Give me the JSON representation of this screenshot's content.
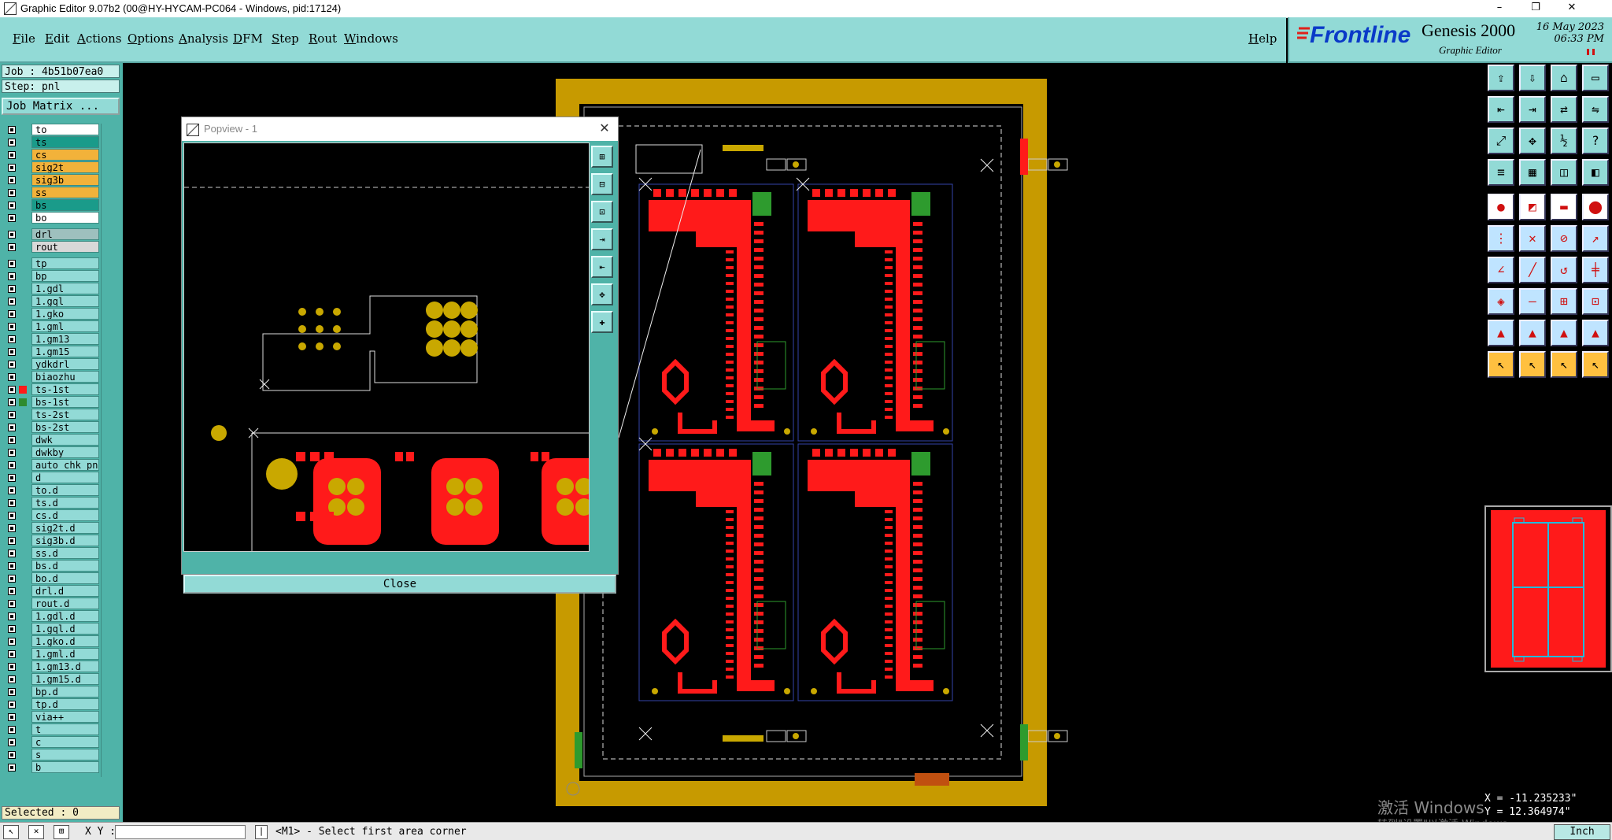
{
  "window": {
    "title": "Graphic Editor 9.07b2 (00@HY-HYCAM-PC064 - Windows, pid:17124)",
    "minimize": "–",
    "restore": "❐",
    "close": "✕"
  },
  "menu": {
    "items": [
      "File",
      "Edit",
      "Actions",
      "Options",
      "Analysis",
      "DFM",
      "Step",
      "Rout",
      "Windows"
    ],
    "help": "Help"
  },
  "logo": {
    "brand": "Frontline",
    "product": "Genesis 2000",
    "subtitle": "Graphic Editor",
    "date": "16 May 2023",
    "time": "06:33 PM"
  },
  "job": {
    "job_label": "Job : 4b51b07ea0",
    "step_label": "Step: pnl",
    "matrix_button": "Job Matrix ..."
  },
  "layers": [
    {
      "name": "to",
      "color": "#ffffff",
      "group": 0
    },
    {
      "name": "ts",
      "color": "#1a9b8a",
      "group": 0
    },
    {
      "name": "cs",
      "color": "#f2b23a",
      "group": 0
    },
    {
      "name": "sig2t",
      "color": "#f2b23a",
      "group": 0
    },
    {
      "name": "sig3b",
      "color": "#f2b23a",
      "group": 0
    },
    {
      "name": "ss",
      "color": "#f2b23a",
      "group": 0
    },
    {
      "name": "bs",
      "color": "#1a9b8a",
      "group": 0
    },
    {
      "name": "bo",
      "color": "#ffffff",
      "group": 0
    },
    {
      "name": "drl",
      "color": "#9ec0be",
      "group": 1
    },
    {
      "name": "rout",
      "color": "#d8d8d8",
      "group": 1
    },
    {
      "name": "tp",
      "color": "#92dad6",
      "group": 2
    },
    {
      "name": "bp",
      "color": "#92dad6",
      "group": 2
    },
    {
      "name": "1.gdl",
      "color": "#92dad6",
      "group": 2
    },
    {
      "name": "1.gql",
      "color": "#92dad6",
      "group": 2
    },
    {
      "name": "1.gko",
      "color": "#92dad6",
      "group": 2
    },
    {
      "name": "1.gml",
      "color": "#92dad6",
      "group": 2
    },
    {
      "name": "1.gm13",
      "color": "#92dad6",
      "group": 2
    },
    {
      "name": "1.gm15",
      "color": "#92dad6",
      "group": 2
    },
    {
      "name": "ydkdrl",
      "color": "#92dad6",
      "group": 2
    },
    {
      "name": "biaozhu",
      "color": "#92dad6",
      "group": 2
    },
    {
      "name": "ts-1st",
      "color": "#92dad6",
      "group": 2,
      "swatch": "#ff1a1a",
      "active": true
    },
    {
      "name": "bs-1st",
      "color": "#92dad6",
      "group": 2,
      "swatch": "#2e8b2e"
    },
    {
      "name": "ts-2st",
      "color": "#92dad6",
      "group": 2
    },
    {
      "name": "bs-2st",
      "color": "#92dad6",
      "group": 2
    },
    {
      "name": "dwk",
      "color": "#92dad6",
      "group": 2
    },
    {
      "name": "dwkby",
      "color": "#92dad6",
      "group": 2
    },
    {
      "name": "auto_chk_pnl",
      "color": "#92dad6",
      "group": 2
    },
    {
      "name": "d",
      "color": "#92dad6",
      "group": 2
    },
    {
      "name": "to.d",
      "color": "#92dad6",
      "group": 2
    },
    {
      "name": "ts.d",
      "color": "#92dad6",
      "group": 2
    },
    {
      "name": "cs.d",
      "color": "#92dad6",
      "group": 2
    },
    {
      "name": "sig2t.d",
      "color": "#92dad6",
      "group": 2
    },
    {
      "name": "sig3b.d",
      "color": "#92dad6",
      "group": 2
    },
    {
      "name": "ss.d",
      "color": "#92dad6",
      "group": 2
    },
    {
      "name": "bs.d",
      "color": "#92dad6",
      "group": 2
    },
    {
      "name": "bo.d",
      "color": "#92dad6",
      "group": 2
    },
    {
      "name": "drl.d",
      "color": "#92dad6",
      "group": 2
    },
    {
      "name": "rout.d",
      "color": "#92dad6",
      "group": 2
    },
    {
      "name": "1.gdl.d",
      "color": "#92dad6",
      "group": 2
    },
    {
      "name": "1.gql.d",
      "color": "#92dad6",
      "group": 2
    },
    {
      "name": "1.gko.d",
      "color": "#92dad6",
      "group": 2
    },
    {
      "name": "1.gml.d",
      "color": "#92dad6",
      "group": 2
    },
    {
      "name": "1.gm13.d",
      "color": "#92dad6",
      "group": 2
    },
    {
      "name": "1.gm15.d",
      "color": "#92dad6",
      "group": 2
    },
    {
      "name": "bp.d",
      "color": "#92dad6",
      "group": 2
    },
    {
      "name": "tp.d",
      "color": "#92dad6",
      "group": 2
    },
    {
      "name": "via++",
      "color": "#92dad6",
      "group": 2
    },
    {
      "name": "t",
      "color": "#92dad6",
      "group": 2
    },
    {
      "name": "c",
      "color": "#92dad6",
      "group": 2
    },
    {
      "name": "s",
      "color": "#92dad6",
      "group": 2
    },
    {
      "name": "b",
      "color": "#92dad6",
      "group": 2
    }
  ],
  "selected_label": "Selected : 0",
  "status": {
    "xy_label": "X Y :",
    "message": "<M1> - Select first area corner",
    "units": "Inch"
  },
  "coords": {
    "x": "X = -11.235233\"",
    "y": "Y = 12.364974\""
  },
  "popview": {
    "title": "Popview - 1",
    "close_button": "Close"
  },
  "watermark": {
    "line1": "激活 Windows",
    "line2": "转到\"设置\"以激活 Windows。"
  },
  "colors": {
    "menu_bg": "#92dad6",
    "panel_bg": "#4fb3a8",
    "frame": "#c79a00",
    "copper": "#ff1a1a",
    "pad": "#c9a800",
    "green": "#2e9b2e"
  }
}
